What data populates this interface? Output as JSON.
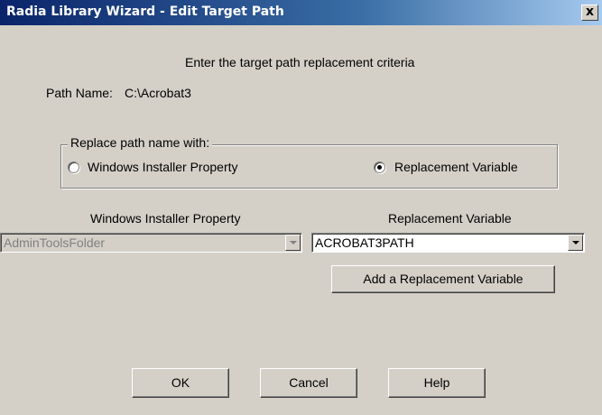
{
  "window": {
    "title": "Radia Library Wizard - Edit Target Path",
    "close_label": "x"
  },
  "main": {
    "instruction": "Enter the target path replacement criteria",
    "path_name_label": "Path Name:",
    "path_name_value": "C:\\Acrobat3"
  },
  "replace_group": {
    "legend": "Replace path name with:",
    "option_installer_property": "Windows Installer Property",
    "option_replacement_variable": "Replacement Variable",
    "selected": "Replacement Variable"
  },
  "installer_property": {
    "label": "Windows Installer Property",
    "value": "AdminToolsFolder",
    "enabled": false
  },
  "replacement_variable": {
    "label": "Replacement Variable",
    "value": "ACROBAT3PATH",
    "add_button": "Add a Replacement Variable"
  },
  "buttons": {
    "ok": "OK",
    "cancel": "Cancel",
    "help": "Help"
  },
  "colors": {
    "title_bar_start": "#0a246a",
    "title_bar_end": "#a6caf0",
    "dialog_face": "#d4d0c8"
  }
}
